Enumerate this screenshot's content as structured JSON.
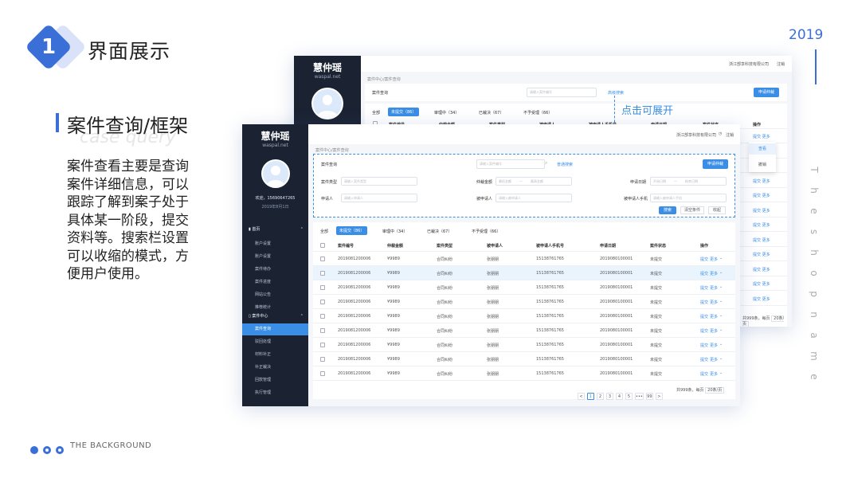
{
  "slide": {
    "number": "1",
    "title": "界面展示",
    "year": "2019",
    "section_title": "案件查询/框架",
    "section_ghost": "case query",
    "description": "案件查看主要是查询案件详细信息，可以跟踪了解到案子处于具体某一阶段，提交资料等。搜索栏设置可以收缩的模式，方便用户使用。",
    "footer": "THE BACKGROUND",
    "vertical_text": [
      "T",
      "h",
      "e",
      "s",
      "h",
      "o",
      "p",
      "n",
      "a",
      "m",
      "e"
    ],
    "callout": "点击可展开"
  },
  "app": {
    "logo": "慧仲瑶",
    "logo_sub": "waspal.net",
    "company": "浙江部享科技有限公司",
    "logout": "注销",
    "welcome": "欢迎，15690647265",
    "date": "2019年8月1日",
    "breadcrumb": "案件中心/案件查询",
    "search_title": "案件查询",
    "search_placeholder": "请输入案件编号",
    "advanced_search": "高级搜索",
    "normal_search": "普通搜索",
    "apply_button": "申请仲裁",
    "nav": {
      "home": "首页",
      "home_items": [
        "账户设置",
        "账户设置",
        "案件待办",
        "案件进度",
        "网站公告",
        "推荐统计"
      ],
      "case_center": "案件中心",
      "case_items": [
        "案件查询",
        "驳回处理",
        "材料补正",
        "补正裁决",
        "回款管理",
        "执行管理"
      ]
    },
    "filters": {
      "case_type_label": "案件类型",
      "case_type_ph": "请输入案件类型",
      "amount_label": "仲裁金额",
      "amount_from": "最低金额",
      "amount_to": "最高金额",
      "apply_date_label": "申请日期",
      "date_from": "开始日期",
      "date_to": "结束日期",
      "applicant_label": "申请人",
      "applicant_ph": "请输入申请人",
      "respondent_label": "被申请人",
      "respondent_ph": "请输入被申请人",
      "respondent_phone_label": "被申请人手机",
      "respondent_phone_ph": "请输入被申请人手机",
      "search_btn": "搜索",
      "clear_btn": "清空条件",
      "collapse_btn": "收起"
    },
    "tabs": [
      "全部",
      "未提交（86）",
      "审理中（34）",
      "已裁决（67）",
      "不予受理（66）"
    ],
    "columns": [
      "案件编号",
      "仲裁金额",
      "案件类型",
      "被申请人",
      "被申请人手机号",
      "申请日期",
      "案件状态",
      "操作"
    ],
    "rows": [
      [
        "2019081200006",
        "¥9989",
        "合同纠纷",
        "张朋朋",
        "15138761765",
        "2019080100001",
        "未提交",
        "提交",
        "更多"
      ],
      [
        "2019081200006",
        "¥9989",
        "合同纠纷",
        "张朋朋",
        "15138761765",
        "2019080100001",
        "未提交",
        "提交",
        "更多"
      ],
      [
        "2019081200006",
        "¥9989",
        "合同纠纷",
        "张朋朋",
        "15138761765",
        "2019080100001",
        "未提交",
        "提交",
        "更多"
      ],
      [
        "2019081200006",
        "¥9989",
        "合同纠纷",
        "张朋朋",
        "15138761765",
        "2019080100001",
        "未提交",
        "提交",
        "更多"
      ],
      [
        "2019081200006",
        "¥9989",
        "合同纠纷",
        "张朋朋",
        "15138761765",
        "2019080100001",
        "未提交",
        "提交",
        "更多"
      ],
      [
        "2019081200006",
        "¥9989",
        "合同纠纷",
        "张朋朋",
        "15138761765",
        "2019080100001",
        "未提交",
        "提交",
        "更多"
      ],
      [
        "2019081200006",
        "¥9989",
        "合同纠纷",
        "张朋朋",
        "15138761765",
        "2019080100001",
        "未提交",
        "提交",
        "更多"
      ],
      [
        "2019081200006",
        "¥9989",
        "合同纠纷",
        "张朋朋",
        "15138761765",
        "2019080100001",
        "未提交",
        "提交",
        "更多"
      ],
      [
        "2019081200006",
        "¥9989",
        "合同纠纷",
        "张朋朋",
        "15138761765",
        "2019080100001",
        "未提交",
        "提交",
        "更多"
      ]
    ],
    "dropdown": [
      "查看",
      "撤销"
    ],
    "back_more": "提交 更多",
    "pagination": {
      "pages": [
        "<",
        "1",
        "2",
        "3",
        "4",
        "5",
        "•••",
        "99",
        ">"
      ],
      "total": "共999条，每页",
      "page_size": "20条/页"
    },
    "back_pagination_total": "共999条，每页",
    "back_page_size": "20条/页"
  }
}
